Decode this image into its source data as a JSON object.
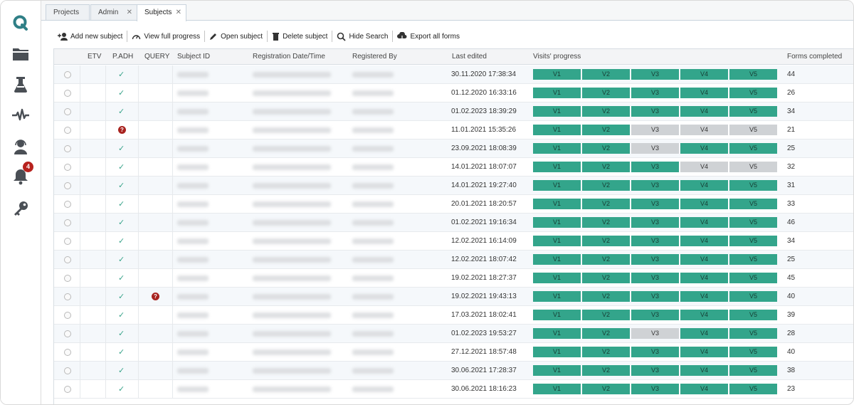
{
  "sidebar": {
    "icons": [
      "q-logo-icon",
      "folder-icon",
      "flask-icon",
      "pulse-icon",
      "support-agent-icon",
      "bell-icon",
      "key-icon"
    ],
    "notification_count": "4"
  },
  "tabs": [
    {
      "label": "Projects",
      "closable": false,
      "active": false
    },
    {
      "label": "Admin",
      "closable": true,
      "active": false
    },
    {
      "label": "Subjects",
      "closable": true,
      "active": true
    }
  ],
  "toolbar": {
    "add": "Add new subject",
    "progress": "View full progress",
    "open": "Open subject",
    "delete": "Delete subject",
    "search": "Hide Search",
    "export": "Export all forms"
  },
  "columns": {
    "etv": "ETV",
    "padh": "P.ADH",
    "query": "QUERY",
    "subject_id": "Subject ID",
    "reg_date": "Registration Date/Time",
    "registered_by": "Registered By",
    "last_edited": "Last edited",
    "visits": "Visits' progress",
    "forms": "Forms completed"
  },
  "colors": {
    "visit_done": "#33a58b",
    "visit_todo": "#cfd2d5",
    "check": "#3aa48b",
    "query_badge": "#a8231f",
    "accent": "#2f7f86"
  },
  "visit_labels": [
    "V1",
    "V2",
    "V3",
    "V4",
    "V5"
  ],
  "rows": [
    {
      "padh": "check",
      "query": "",
      "last_edited": "30.11.2020 17:38:34",
      "visits": [
        1,
        1,
        1,
        1,
        1
      ],
      "forms": "44"
    },
    {
      "padh": "check",
      "query": "",
      "last_edited": "01.12.2020 16:33:16",
      "visits": [
        1,
        1,
        1,
        1,
        1
      ],
      "forms": "26"
    },
    {
      "padh": "check",
      "query": "",
      "last_edited": "01.02.2023 18:39:29",
      "visits": [
        1,
        1,
        1,
        1,
        1
      ],
      "forms": "34"
    },
    {
      "padh": "question",
      "query": "",
      "last_edited": "11.01.2021 15:35:26",
      "visits": [
        1,
        1,
        0,
        0,
        0
      ],
      "forms": "21"
    },
    {
      "padh": "check",
      "query": "",
      "last_edited": "23.09.2021 18:08:39",
      "visits": [
        1,
        1,
        0,
        1,
        1
      ],
      "forms": "25"
    },
    {
      "padh": "check",
      "query": "",
      "last_edited": "14.01.2021 18:07:07",
      "visits": [
        1,
        1,
        1,
        0,
        0
      ],
      "forms": "32"
    },
    {
      "padh": "check",
      "query": "",
      "last_edited": "14.01.2021 19:27:40",
      "visits": [
        1,
        1,
        1,
        1,
        1
      ],
      "forms": "31"
    },
    {
      "padh": "check",
      "query": "",
      "last_edited": "20.01.2021 18:20:57",
      "visits": [
        1,
        1,
        1,
        1,
        1
      ],
      "forms": "33"
    },
    {
      "padh": "check",
      "query": "",
      "last_edited": "01.02.2021 19:16:34",
      "visits": [
        1,
        1,
        1,
        1,
        1
      ],
      "forms": "46"
    },
    {
      "padh": "check",
      "query": "",
      "last_edited": "12.02.2021 16:14:09",
      "visits": [
        1,
        1,
        1,
        1,
        1
      ],
      "forms": "34"
    },
    {
      "padh": "check",
      "query": "",
      "last_edited": "12.02.2021 18:07:42",
      "visits": [
        1,
        1,
        1,
        1,
        1
      ],
      "forms": "25"
    },
    {
      "padh": "check",
      "query": "",
      "last_edited": "19.02.2021 18:27:37",
      "visits": [
        1,
        1,
        1,
        1,
        1
      ],
      "forms": "45"
    },
    {
      "padh": "check",
      "query": "question",
      "last_edited": "19.02.2021 19:43:13",
      "visits": [
        1,
        1,
        1,
        1,
        1
      ],
      "forms": "40"
    },
    {
      "padh": "check",
      "query": "",
      "last_edited": "17.03.2021 18:02:41",
      "visits": [
        1,
        1,
        1,
        1,
        1
      ],
      "forms": "39"
    },
    {
      "padh": "check",
      "query": "",
      "last_edited": "01.02.2023 19:53:27",
      "visits": [
        1,
        1,
        0,
        1,
        1
      ],
      "forms": "28"
    },
    {
      "padh": "check",
      "query": "",
      "last_edited": "27.12.2021 18:57:48",
      "visits": [
        1,
        1,
        1,
        1,
        1
      ],
      "forms": "40"
    },
    {
      "padh": "check",
      "query": "",
      "last_edited": "30.06.2021 17:28:37",
      "visits": [
        1,
        1,
        1,
        1,
        1
      ],
      "forms": "38"
    },
    {
      "padh": "check",
      "query": "",
      "last_edited": "30.06.2021 18:16:23",
      "visits": [
        1,
        1,
        1,
        1,
        1
      ],
      "forms": "23"
    }
  ]
}
